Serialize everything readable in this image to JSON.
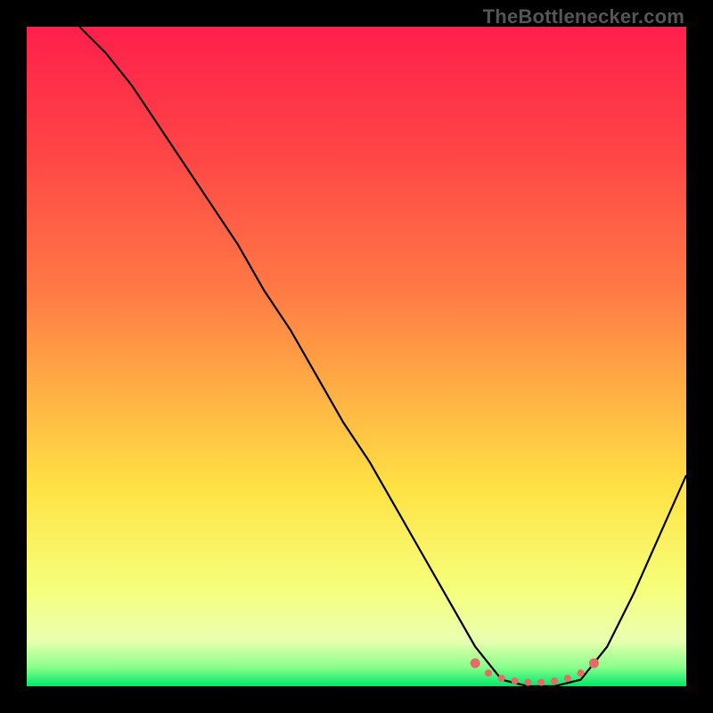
{
  "watermark": "TheBottlenecker.com",
  "chart_data": {
    "type": "line",
    "title": "",
    "xlabel": "",
    "ylabel": "",
    "xlim": [
      0,
      100
    ],
    "ylim": [
      0,
      100
    ],
    "grid": false,
    "series": [
      {
        "name": "curve",
        "x": [
          8,
          12,
          16,
          20,
          24,
          28,
          32,
          36,
          40,
          44,
          48,
          52,
          56,
          60,
          64,
          68,
          72,
          76,
          80,
          84,
          88,
          92,
          96,
          100
        ],
        "values": [
          100,
          96,
          91,
          85,
          79,
          73,
          67,
          60,
          54,
          47,
          40,
          34,
          27,
          20,
          13,
          6,
          1,
          0,
          0,
          1,
          6,
          14,
          23,
          32
        ]
      }
    ],
    "markers": {
      "name": "highlight",
      "x": [
        68,
        70,
        72,
        74,
        76,
        78,
        80,
        82,
        84,
        86
      ],
      "values": [
        3.5,
        2.0,
        1.2,
        0.8,
        0.6,
        0.6,
        0.8,
        1.2,
        2.0,
        3.5
      ],
      "color": "#e66a66"
    },
    "gradient_stops": [
      {
        "offset": 0,
        "color": "#ff1f4b"
      },
      {
        "offset": 20,
        "color": "#ff4746"
      },
      {
        "offset": 40,
        "color": "#ff7a45"
      },
      {
        "offset": 55,
        "color": "#ffae44"
      },
      {
        "offset": 70,
        "color": "#ffe244"
      },
      {
        "offset": 85,
        "color": "#f6ff7a"
      },
      {
        "offset": 93,
        "color": "#eaffb0"
      },
      {
        "offset": 97,
        "color": "#8dff8d"
      },
      {
        "offset": 100,
        "color": "#00e86b"
      }
    ]
  }
}
